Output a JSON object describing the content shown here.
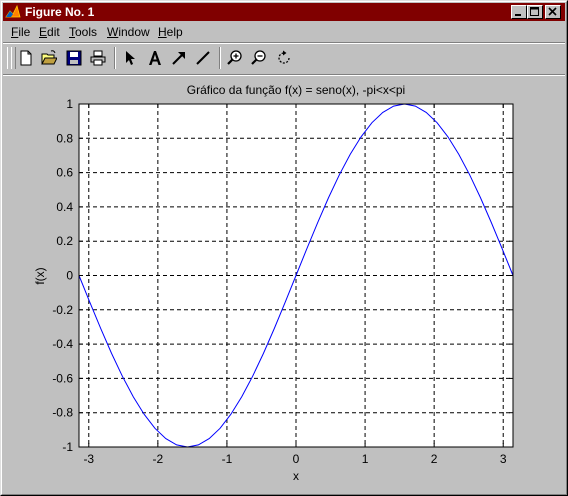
{
  "window": {
    "title": "Figure No. 1",
    "titlebar_color": "#800000",
    "controls": [
      "minimize-icon",
      "maximize-icon",
      "close-icon"
    ]
  },
  "menu": {
    "items": [
      {
        "label": "File",
        "accel": "F"
      },
      {
        "label": "Edit",
        "accel": "E"
      },
      {
        "label": "Tools",
        "accel": "T"
      },
      {
        "label": "Window",
        "accel": "W"
      },
      {
        "label": "Help",
        "accel": "H"
      }
    ]
  },
  "toolbar": {
    "buttons": [
      "new-figure-icon",
      "open-file-icon",
      "save-icon",
      "print-icon",
      "select-arrow-icon",
      "insert-text-icon",
      "insert-arrow-icon",
      "insert-line-icon",
      "zoom-in-icon",
      "zoom-out-icon",
      "rotate-3d-icon"
    ]
  },
  "chart_data": {
    "type": "line",
    "title": "Gráfico da função f(x) = seno(x), -pi<x<pi",
    "xlabel": "x",
    "ylabel": "f(x)",
    "xlim": [
      -3.14159,
      3.14159
    ],
    "ylim": [
      -1,
      1
    ],
    "xticks": [
      -3,
      -2,
      -1,
      0,
      1,
      2,
      3
    ],
    "xtick_labels": [
      "-3",
      "-2",
      "-1",
      "0",
      "1",
      "2",
      "3"
    ],
    "yticks": [
      -1,
      -0.8,
      -0.6,
      -0.4,
      -0.2,
      0,
      0.2,
      0.4,
      0.6,
      0.8,
      1
    ],
    "ytick_labels": [
      "-1",
      "-0.8",
      "-0.6",
      "-0.4",
      "-0.2",
      "0",
      "0.2",
      "0.4",
      "0.6",
      "0.8",
      "1"
    ],
    "grid": "dashed",
    "series": [
      {
        "color": "#0000ff",
        "x": [
          -3.1416,
          -2.9845,
          -2.8274,
          -2.6704,
          -2.5133,
          -2.3562,
          -2.1991,
          -2.042,
          -1.885,
          -1.7279,
          -1.5708,
          -1.4137,
          -1.2566,
          -1.0996,
          -0.9425,
          -0.7854,
          -0.6283,
          -0.4712,
          -0.3142,
          -0.1571,
          0,
          0.1571,
          0.3142,
          0.4712,
          0.6283,
          0.7854,
          0.9425,
          1.0996,
          1.2566,
          1.4137,
          1.5708,
          1.7279,
          1.885,
          2.042,
          2.1991,
          2.3562,
          2.5133,
          2.6704,
          2.8274,
          2.9845,
          3.1416
        ],
        "y": [
          0,
          -0.1564,
          -0.309,
          -0.454,
          -0.5878,
          -0.7071,
          -0.809,
          -0.891,
          -0.9511,
          -0.9877,
          -1,
          -0.9877,
          -0.9511,
          -0.891,
          -0.809,
          -0.7071,
          -0.5878,
          -0.454,
          -0.309,
          -0.1564,
          0,
          0.1564,
          0.309,
          0.454,
          0.5878,
          0.7071,
          0.809,
          0.891,
          0.9511,
          0.9877,
          1,
          0.9877,
          0.9511,
          0.891,
          0.809,
          0.7071,
          0.5878,
          0.454,
          0.309,
          0.1564,
          0
        ]
      }
    ]
  }
}
